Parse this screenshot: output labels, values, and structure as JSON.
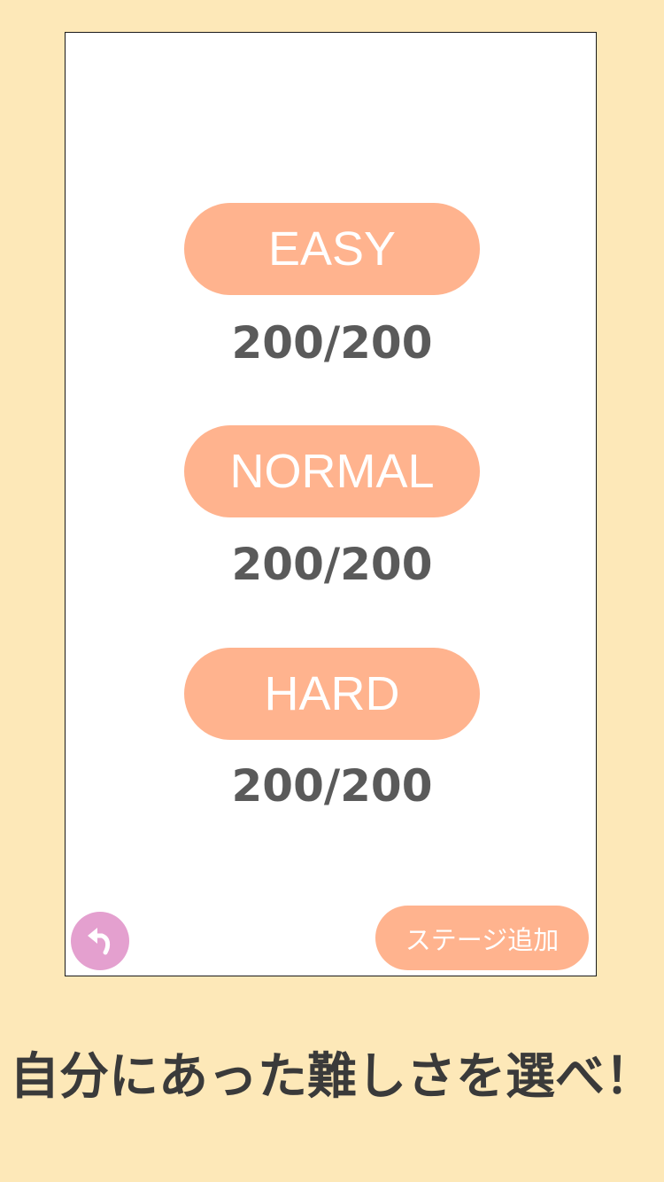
{
  "levels": [
    {
      "label": "EASY",
      "progress": "200/200"
    },
    {
      "label": "NORMAL",
      "progress": "200/200"
    },
    {
      "label": "HARD",
      "progress": "200/200"
    }
  ],
  "footer": {
    "back_icon": "undo-arrow-icon",
    "add_stage_label": "ステージ追加"
  },
  "caption": "自分にあった難しさを選べ！",
  "colors": {
    "background": "#fde8b8",
    "button": "#ffb38e",
    "back_button": "#e4a0cf",
    "progress_text": "#5a5a5a",
    "caption_text": "#3a3a3a"
  }
}
